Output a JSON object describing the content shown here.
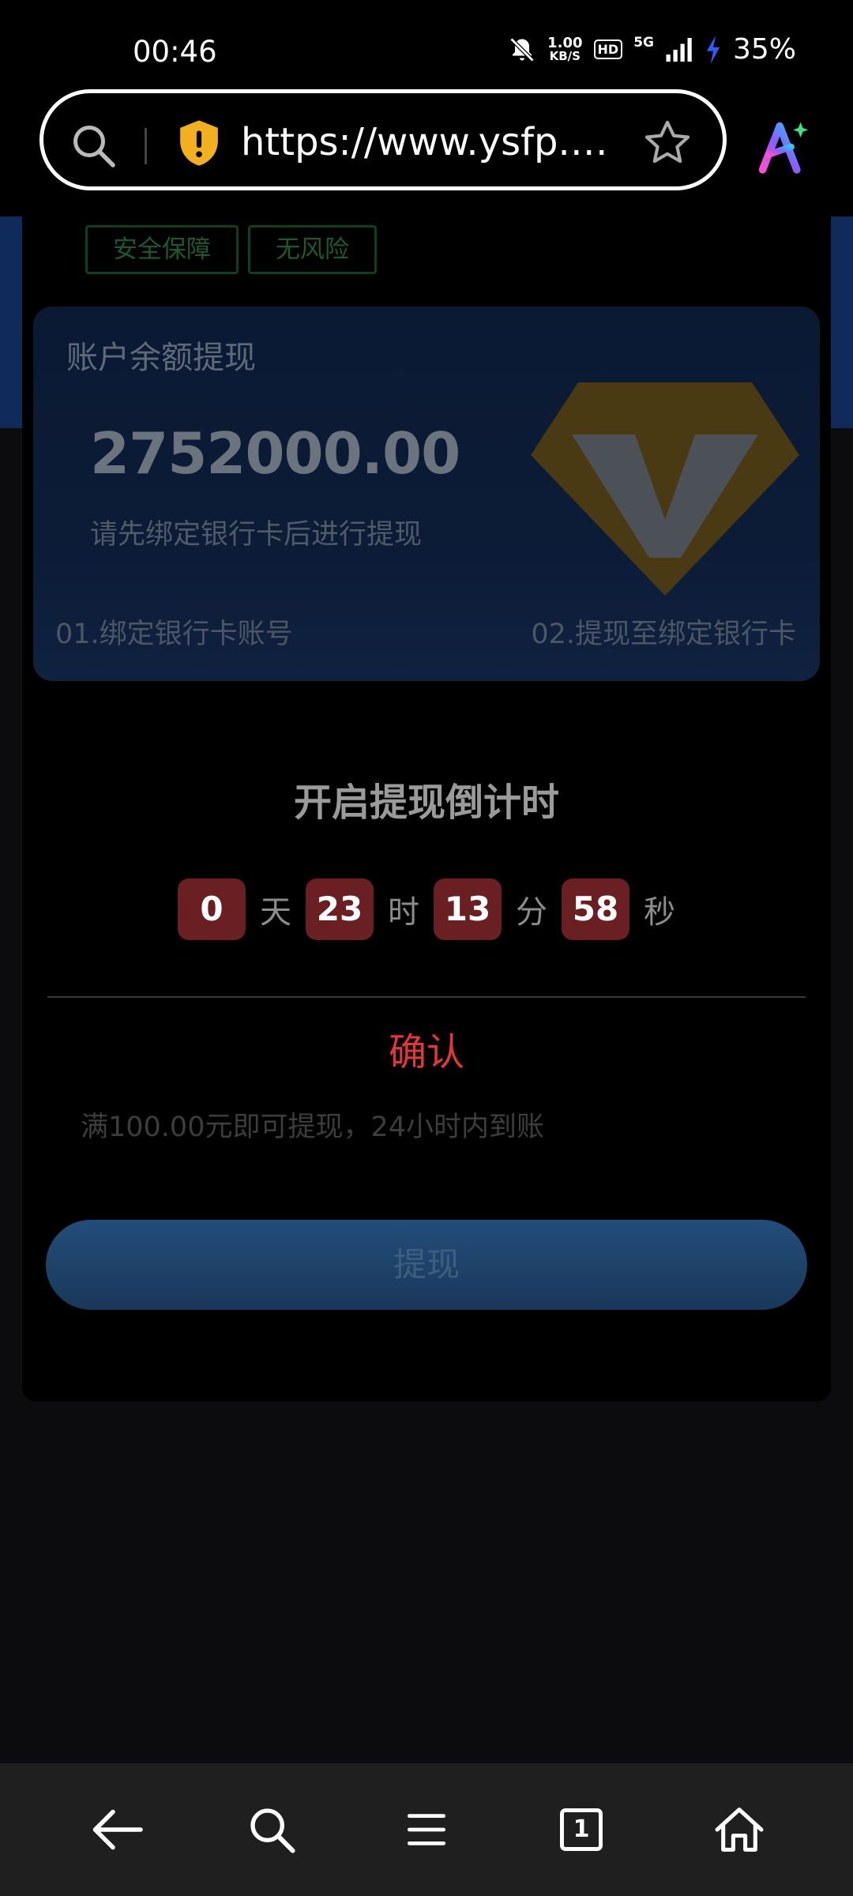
{
  "status_bar": {
    "time": "00:46",
    "net_speed_value": "1.00",
    "net_speed_unit": "KB/S",
    "hd": "HD",
    "network": "5G",
    "battery": "35%",
    "icons": [
      "mute-bell-icon",
      "signal-icon",
      "charging-bolt-icon"
    ]
  },
  "browser": {
    "url": "https://www.ysfp.net",
    "icons": [
      "search-icon",
      "security-warning-shield-icon",
      "bookmark-star-icon",
      "ai-assistant-icon"
    ]
  },
  "page": {
    "tags": [
      "安全保障",
      "无风险"
    ],
    "balance_card": {
      "title": "账户余额提现",
      "amount": "2752000.00",
      "hint": "请先绑定银行卡后进行提现",
      "step_1": "01.绑定银行卡账号",
      "step_2": "02.提现至绑定银行卡",
      "icon": "vip-diamond-icon"
    },
    "countdown": {
      "title": "开启提现倒计时",
      "days": "0",
      "days_unit": "天",
      "hours": "23",
      "hours_unit": "时",
      "minutes": "13",
      "minutes_unit": "分",
      "seconds": "58",
      "seconds_unit": "秒"
    },
    "confirm_label": "确认",
    "withdraw_rule": "满100.00元即可提现，24小时内到账",
    "withdraw_button": "提现"
  },
  "bottom_nav": {
    "tab_count": "1",
    "icons": [
      "back-arrow-icon",
      "search-icon",
      "menu-icon",
      "tabs-icon",
      "home-icon"
    ]
  },
  "colors": {
    "accent_red": "#e0383a",
    "countdown_box": "#6a1f22",
    "banner_blue": "#102a5c"
  }
}
